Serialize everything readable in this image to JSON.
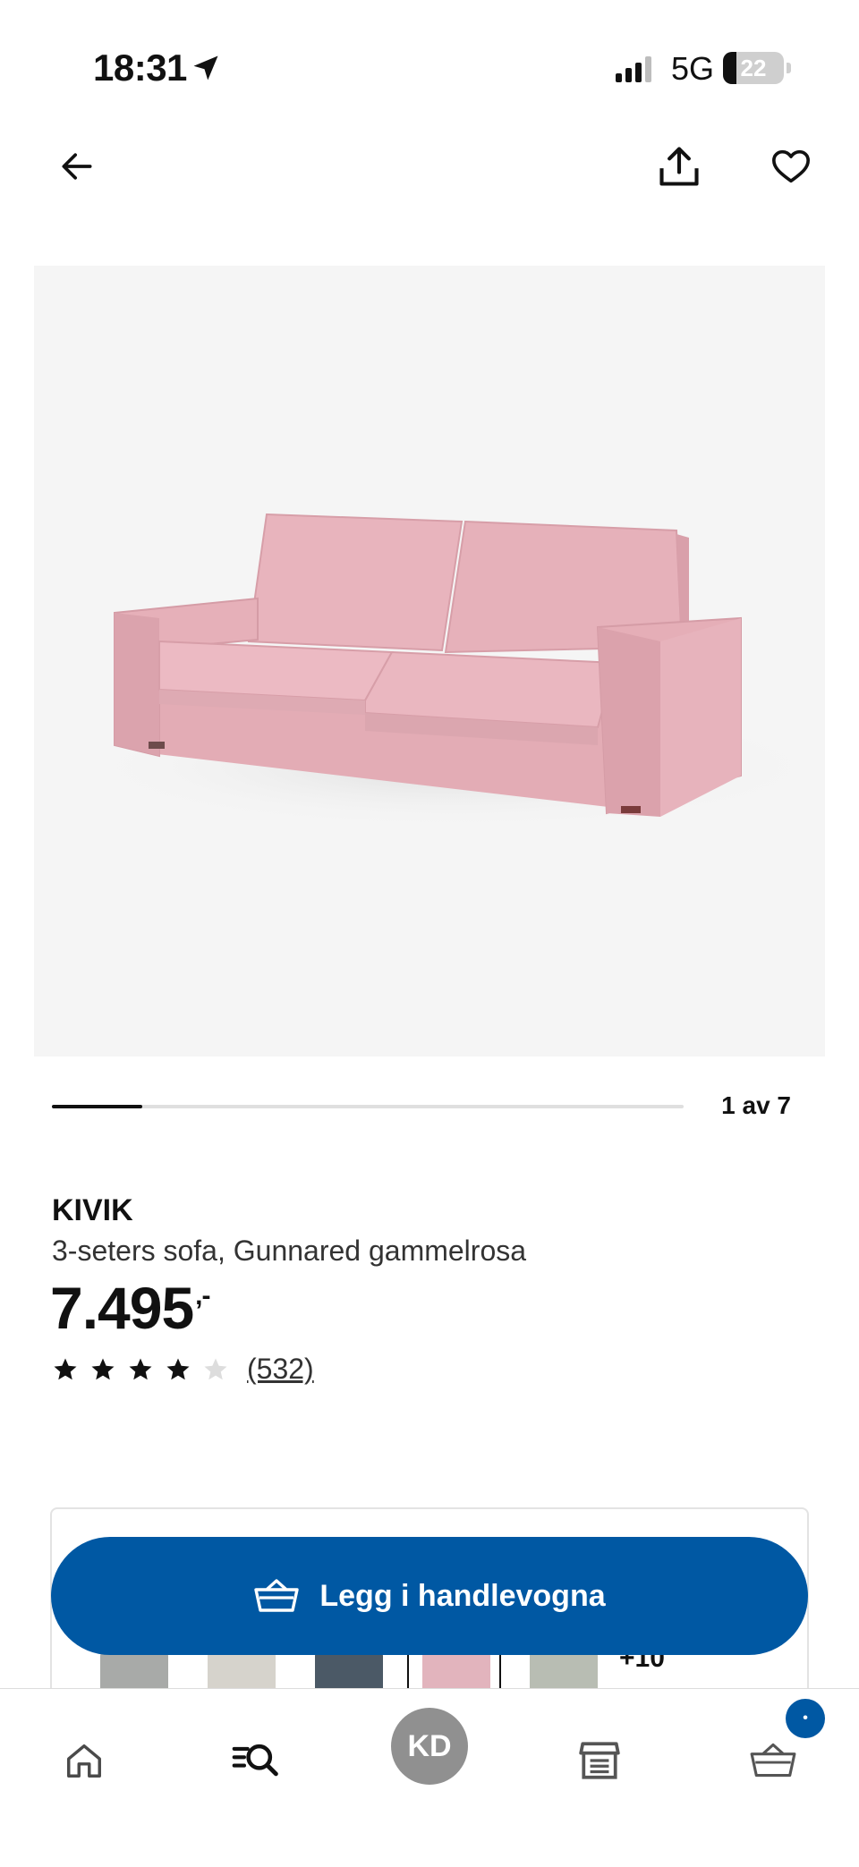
{
  "status_bar": {
    "time": "18:31",
    "network": "5G",
    "battery_level": "22",
    "battery_fraction": 0.22
  },
  "nav": {
    "back_icon": "arrow-left-icon",
    "share_icon": "share-icon",
    "favorite_icon": "heart-icon"
  },
  "gallery": {
    "counter": "1 av 7",
    "progress_fraction": 0.143
  },
  "product": {
    "brand": "KIVIK",
    "description": "3-seters sofa, Gunnared gammelrosa",
    "price": "7.495",
    "price_suffix": ",-",
    "rating": 4,
    "rating_max": 5,
    "review_count": "(532)"
  },
  "variants": {
    "more_label": "+10",
    "swatch_colors": [
      "#a8aaa8",
      "#d6d3cc",
      "#4b5966",
      "#e2b4bd",
      "#b8bdb3"
    ]
  },
  "cta": {
    "label": "Legg i handlevogna",
    "icon": "basket-icon",
    "color": "#0058a3"
  },
  "tab_bar": {
    "items": [
      {
        "icon": "home-icon"
      },
      {
        "icon": "search-icon"
      },
      {
        "icon": "avatar",
        "initials": "KD"
      },
      {
        "icon": "store-icon"
      },
      {
        "icon": "basket-icon"
      }
    ],
    "cart_badge": "•"
  },
  "colors": {
    "accent": "#0058a3",
    "product_color": "#e9b8bf"
  }
}
